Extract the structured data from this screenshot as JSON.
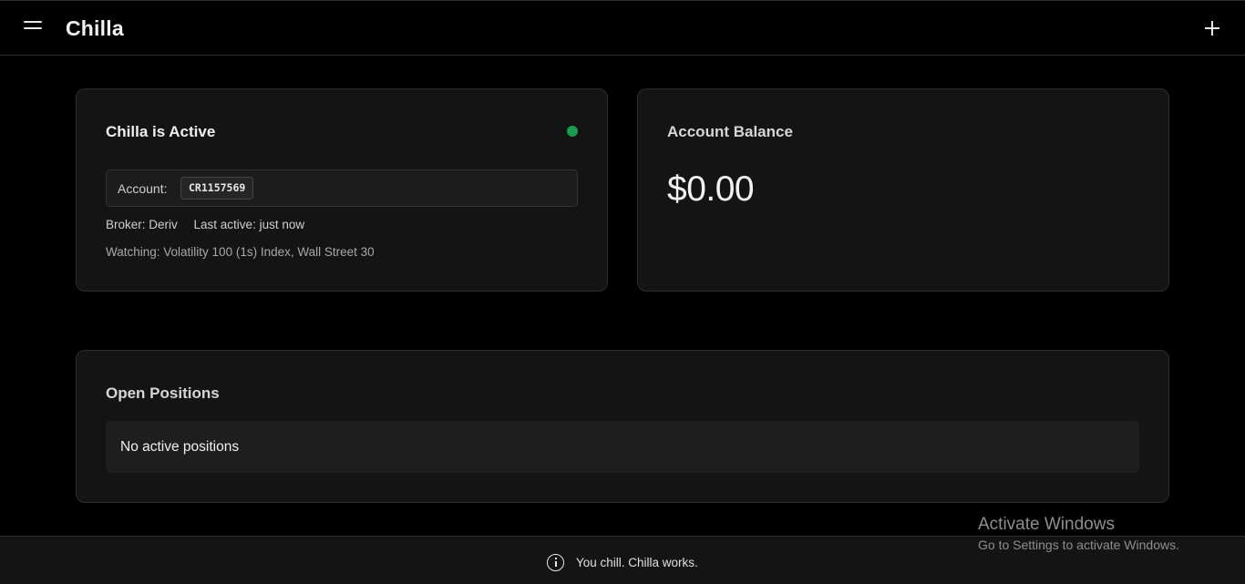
{
  "header": {
    "menu_icon": "hamburger-menu-icon",
    "title": "Chilla",
    "add_icon": "plus-icon"
  },
  "status_card": {
    "title": "Chilla is Active",
    "status_color": "#1a9c4e",
    "account_label": "Account:",
    "account_id": "CR1157569",
    "broker": "Broker: Deriv",
    "last_active": "Last active: just now",
    "watching": "Watching: Volatility 100 (1s) Index, Wall Street 30"
  },
  "balance_card": {
    "title": "Account Balance",
    "value": "$0.00"
  },
  "positions_card": {
    "title": "Open Positions",
    "empty_message": "No active positions"
  },
  "footer": {
    "icon": "info-icon",
    "message": "You chill. Chilla works."
  },
  "watermark": {
    "title": "Activate Windows",
    "subtitle": "Go to Settings to activate Windows."
  }
}
